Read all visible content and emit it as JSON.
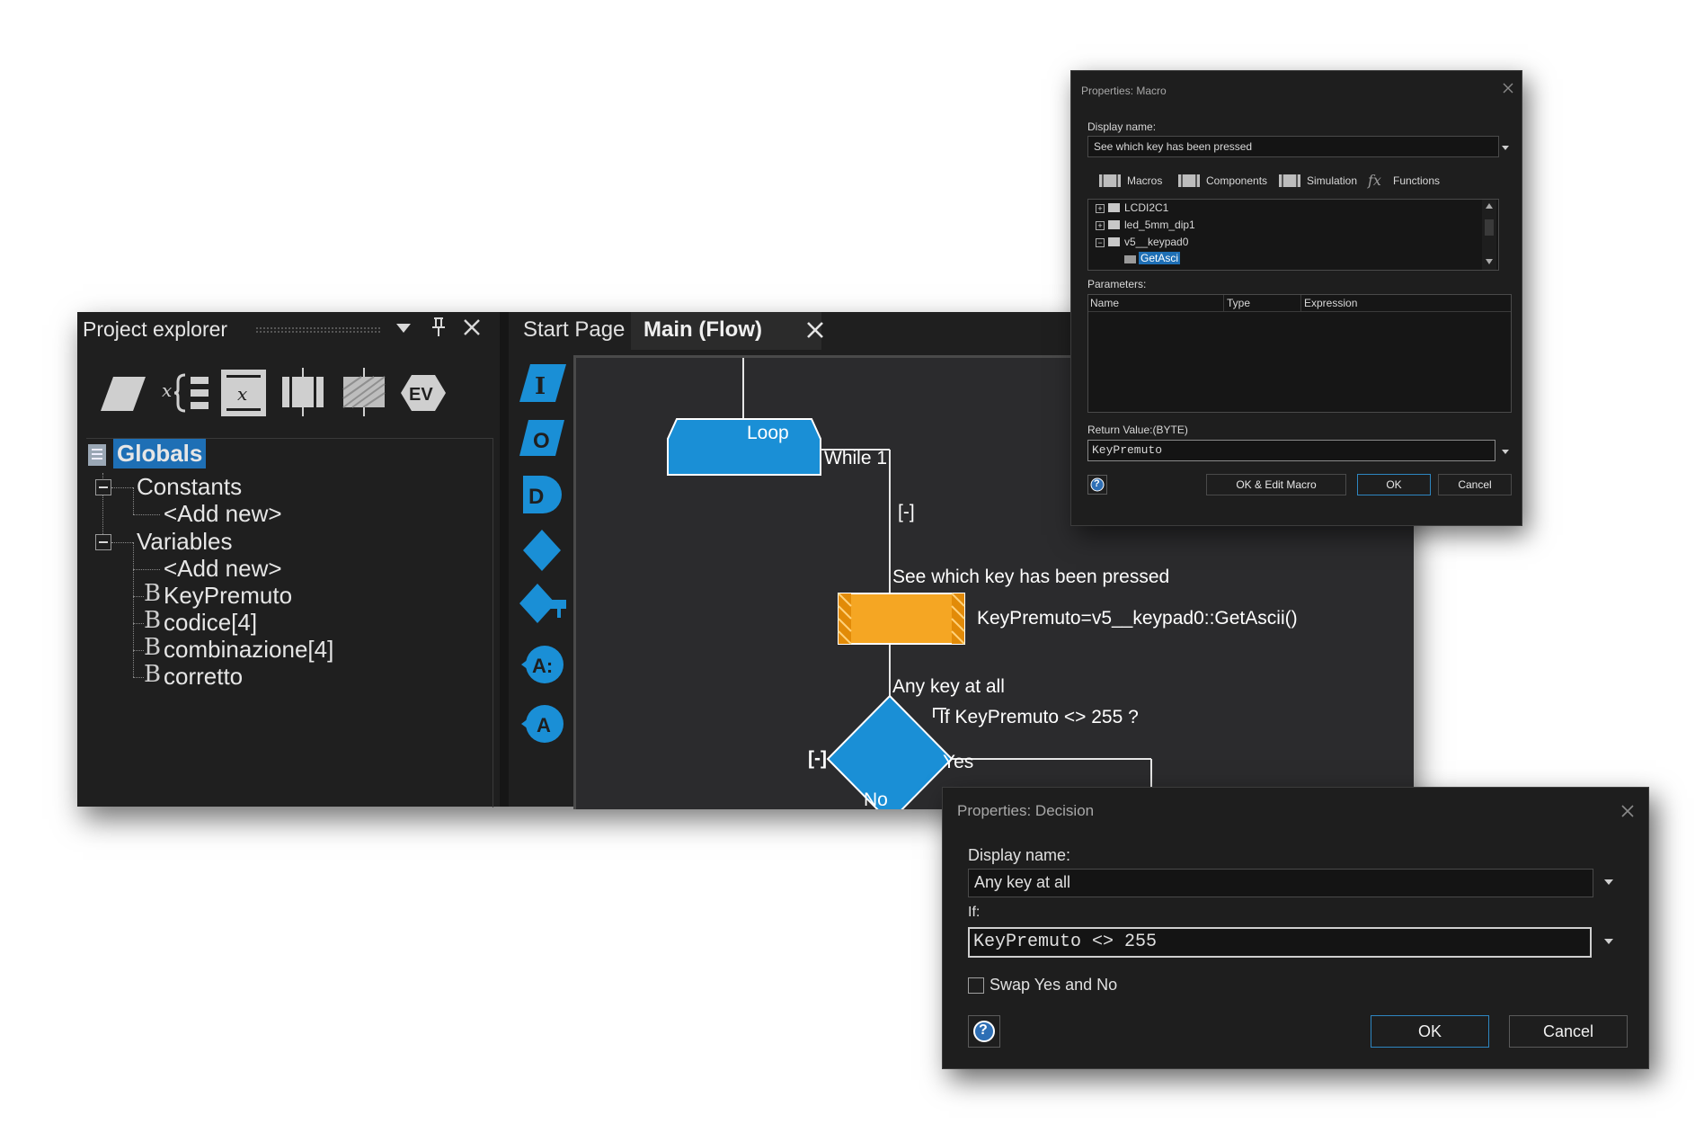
{
  "explorer": {
    "title": "Project explorer",
    "tree": {
      "root": "Globals",
      "constants": "Constants",
      "constants_add": "<Add new>",
      "variables": "Variables",
      "variables_add": "<Add new>",
      "vars": [
        "KeyPremuto",
        "codice[4]",
        "combinazione[4]",
        "corretto"
      ]
    },
    "toolbar_icons": [
      "parallelogram-icon",
      "variable-braces-icon",
      "calculation-icon",
      "component-macro-icon",
      "macro-icon",
      "event-icon"
    ],
    "toolbar_ev_label": "EV"
  },
  "tabs": {
    "start": "Start Page",
    "main": "Main (Flow)"
  },
  "palette": {
    "input": "I",
    "output": "O",
    "delay": "D",
    "connection_point": "A:",
    "goto": "A"
  },
  "flow": {
    "loop_label": "Loop",
    "while_label": "While 1",
    "collapse_1": "[-]",
    "macro_display": "See which key has been pressed",
    "macro_call": "KeyPremuto=v5__keypad0::GetAscii()",
    "decision_display": "Any key at all",
    "decision_cond": "If KeyPremuto <> 255 ?",
    "collapse_2": "[-]",
    "yes": "Yes",
    "no": "No"
  },
  "macro_dialog": {
    "title": "Properties: Macro",
    "display_name_label": "Display name:",
    "display_name_value": "See which key has been pressed",
    "tabs": [
      "Macros",
      "Components",
      "Simulation",
      "Functions"
    ],
    "functions_glyph": "fx",
    "tree": [
      "LCDI2C1",
      "led_5mm_dip1",
      "v5__keypad0",
      "GetAsci"
    ],
    "parameters_label": "Parameters:",
    "columns": [
      "Name",
      "Type",
      "Expression"
    ],
    "return_label": "Return Value:(BYTE)",
    "return_value": "KeyPremuto",
    "help": "?",
    "buttons": {
      "edit": "OK & Edit Macro",
      "ok": "OK",
      "cancel": "Cancel"
    }
  },
  "decision_dialog": {
    "title": "Properties: Decision",
    "display_name_label": "Display name:",
    "display_name_value": "Any key at all",
    "if_label": "If:",
    "if_value": "KeyPremuto <> 255",
    "swap_label": "Swap Yes and No",
    "swap_checked": false,
    "help": "?",
    "buttons": {
      "ok": "OK",
      "cancel": "Cancel"
    }
  },
  "colors": {
    "flow_blue": "#1a8fd6",
    "macro_orange": "#f5a623",
    "selection": "#1e6fb5",
    "accent_button": "#2e86c1"
  }
}
